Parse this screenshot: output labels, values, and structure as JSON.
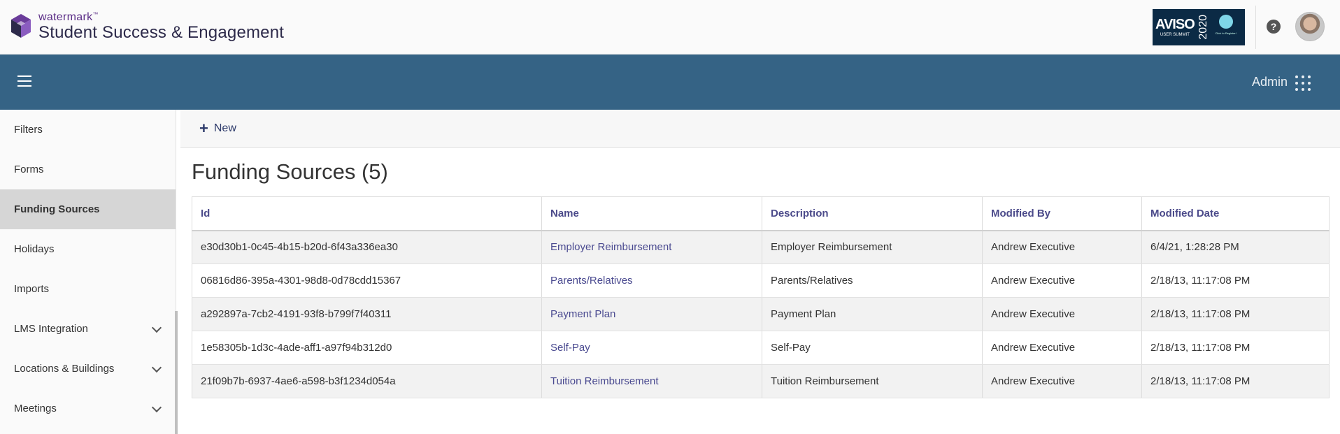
{
  "header": {
    "brand_small": "watermark",
    "brand_tm": "™",
    "brand_main": "Student Success & Engagement",
    "banner": {
      "title": "AVISO",
      "subtitle": "USER SUMMIT",
      "year": "2020",
      "cta": "Click to Register!"
    },
    "help_icon": "question-circle-icon",
    "avatar": "user-avatar"
  },
  "navbar": {
    "menu_icon": "hamburger-icon",
    "admin_label": "Admin",
    "apps_icon": "app-grid-icon"
  },
  "sidebar": {
    "items": [
      {
        "label": "Filters",
        "expandable": false,
        "active": false
      },
      {
        "label": "Forms",
        "expandable": false,
        "active": false
      },
      {
        "label": "Funding Sources",
        "expandable": false,
        "active": true
      },
      {
        "label": "Holidays",
        "expandable": false,
        "active": false
      },
      {
        "label": "Imports",
        "expandable": false,
        "active": false
      },
      {
        "label": "LMS Integration",
        "expandable": true,
        "active": false
      },
      {
        "label": "Locations & Buildings",
        "expandable": true,
        "active": false
      },
      {
        "label": "Meetings",
        "expandable": true,
        "active": false
      }
    ]
  },
  "toolbar": {
    "new_label": "New"
  },
  "main": {
    "title": "Funding Sources (5)",
    "columns": [
      "Id",
      "Name",
      "Description",
      "Modified By",
      "Modified Date"
    ],
    "rows": [
      {
        "id": "e30d30b1-0c45-4b15-b20d-6f43a336ea30",
        "name": "Employer Reimbursement",
        "description": "Employer Reimbursement",
        "modified_by": "Andrew Executive",
        "modified_date": "6/4/21, 1:28:28 PM"
      },
      {
        "id": "06816d86-395a-4301-98d8-0d78cdd15367",
        "name": "Parents/Relatives",
        "description": "Parents/Relatives",
        "modified_by": "Andrew Executive",
        "modified_date": "2/18/13, 11:17:08 PM"
      },
      {
        "id": "a292897a-7cb2-4191-93f8-b799f7f40311",
        "name": "Payment Plan",
        "description": "Payment Plan",
        "modified_by": "Andrew Executive",
        "modified_date": "2/18/13, 11:17:08 PM"
      },
      {
        "id": "1e58305b-1d3c-4ade-aff1-a97f94b312d0",
        "name": "Self-Pay",
        "description": "Self-Pay",
        "modified_by": "Andrew Executive",
        "modified_date": "2/18/13, 11:17:08 PM"
      },
      {
        "id": "21f09b7b-6937-4ae6-a598-b3f1234d054a",
        "name": "Tuition Reimbursement",
        "description": "Tuition Reimbursement",
        "modified_by": "Andrew Executive",
        "modified_date": "2/18/13, 11:17:08 PM"
      }
    ]
  },
  "colors": {
    "navbar": "#356385",
    "link": "#4a4a90",
    "active_item": "#d6d6d6"
  }
}
